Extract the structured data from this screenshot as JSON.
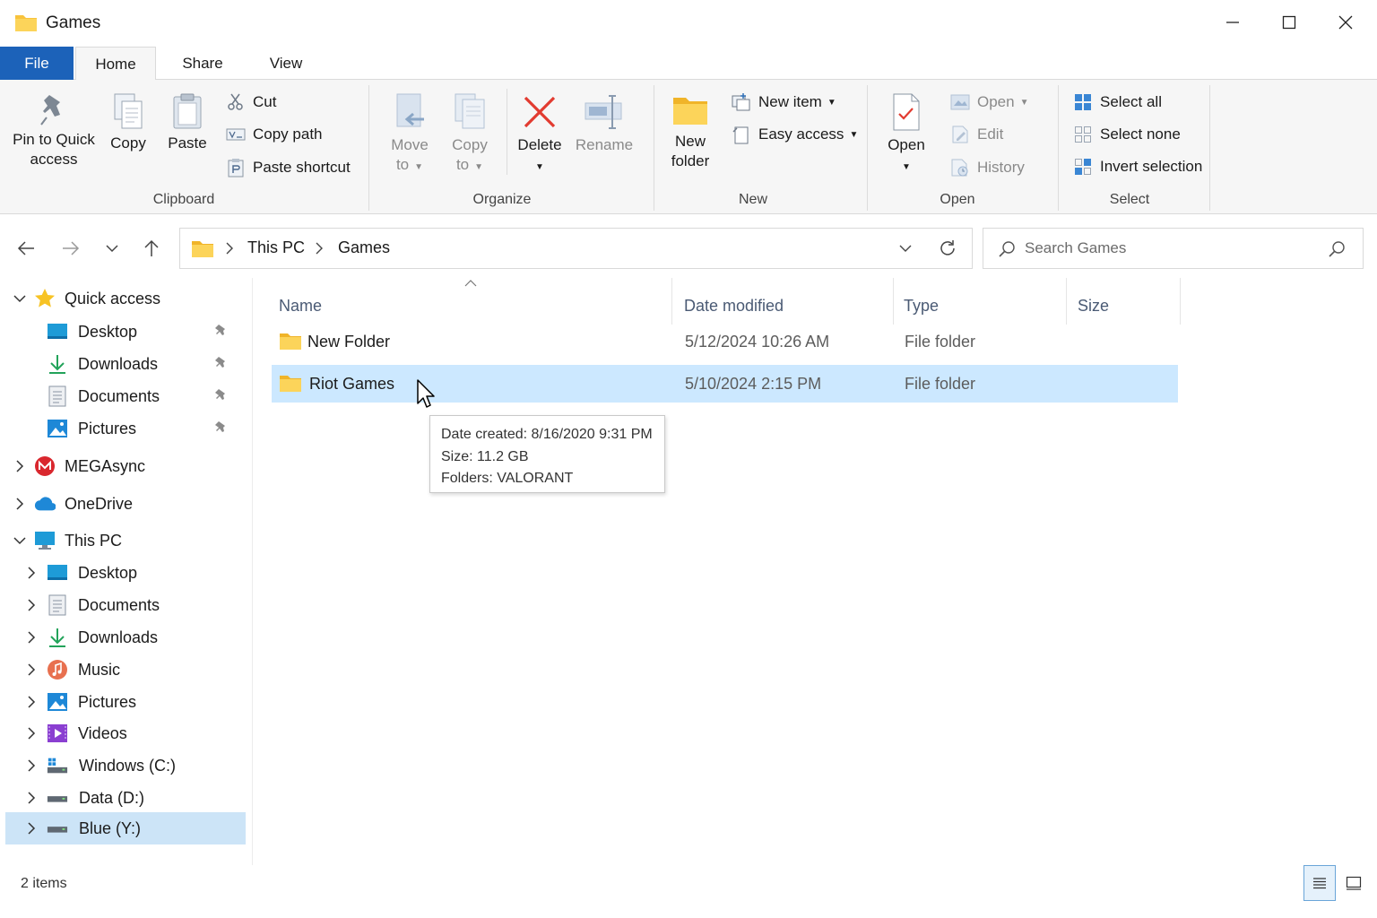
{
  "window": {
    "title": "Games",
    "controls": {
      "minimize": "minimize",
      "maximize": "maximize",
      "close": "close"
    }
  },
  "ribbon_tabs": [
    "File",
    "Home",
    "Share",
    "View"
  ],
  "ribbon": {
    "clipboard": {
      "label": "Clipboard",
      "pin_line1": "Pin to Quick",
      "pin_line2": "access",
      "copy": "Copy",
      "paste": "Paste",
      "cut": "Cut",
      "copy_path": "Copy path",
      "paste_shortcut": "Paste shortcut"
    },
    "organize": {
      "label": "Organize",
      "move_line1": "Move",
      "move_line2": "to",
      "copy_line1": "Copy",
      "copy_line2": "to",
      "delete": "Delete",
      "rename": "Rename"
    },
    "new": {
      "label": "New",
      "new_folder_line1": "New",
      "new_folder_line2": "folder",
      "new_item": "New item",
      "easy_access": "Easy access"
    },
    "open": {
      "label": "Open",
      "open_big": "Open",
      "open": "Open",
      "edit": "Edit",
      "history": "History"
    },
    "select": {
      "label": "Select",
      "select_all": "Select all",
      "select_none": "Select none",
      "invert_selection": "Invert selection"
    }
  },
  "address": {
    "crumbs": [
      "This PC",
      "Games"
    ],
    "search_placeholder": "Search Games"
  },
  "navpane": {
    "items": [
      {
        "label": "Quick access",
        "icon": "star-icon"
      },
      {
        "label": "Desktop",
        "icon": "desktop-icon"
      },
      {
        "label": "Downloads",
        "icon": "download-icon"
      },
      {
        "label": "Documents",
        "icon": "document-icon"
      },
      {
        "label": "Pictures",
        "icon": "pictures-icon"
      },
      {
        "label": "MEGAsync",
        "icon": "mega-icon"
      },
      {
        "label": "OneDrive",
        "icon": "cloud-icon"
      },
      {
        "label": "This PC",
        "icon": "computer-icon"
      },
      {
        "label": "Desktop",
        "icon": "desktop-icon"
      },
      {
        "label": "Documents",
        "icon": "document-icon"
      },
      {
        "label": "Downloads",
        "icon": "download-icon"
      },
      {
        "label": "Music",
        "icon": "music-icon"
      },
      {
        "label": "Pictures",
        "icon": "pictures-icon"
      },
      {
        "label": "Videos",
        "icon": "videos-icon"
      },
      {
        "label": "Windows (C:)",
        "icon": "windows-drive-icon"
      },
      {
        "label": "Data (D:)",
        "icon": "drive-icon"
      },
      {
        "label": "Blue (Y:)",
        "icon": "drive-icon"
      }
    ]
  },
  "columns": [
    "Name",
    "Date modified",
    "Type",
    "Size"
  ],
  "files": [
    {
      "name": "New Folder",
      "date": "5/12/2024 10:26 AM",
      "type": "File folder",
      "size": ""
    },
    {
      "name": "Riot Games",
      "date": "5/10/2024 2:15 PM",
      "type": "File folder",
      "size": ""
    }
  ],
  "tooltip": {
    "line1": "Date created: 8/16/2020 9:31 PM",
    "line2": "Size: 11.2 GB",
    "line3": "Folders: VALORANT"
  },
  "status": {
    "count": "2 items"
  },
  "colors": {
    "accent": "#1c62b9",
    "selection": "#cce8ff",
    "folder": "#f8c33c"
  }
}
